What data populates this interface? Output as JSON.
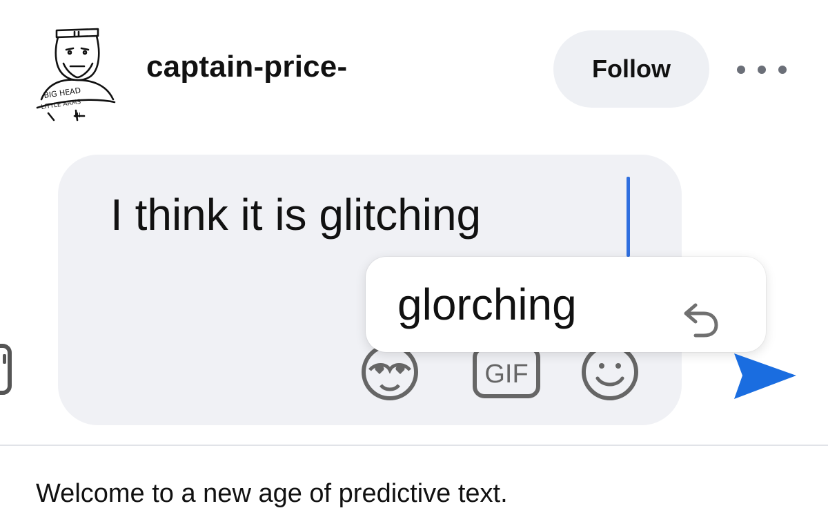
{
  "post": {
    "author": {
      "username": "captain-price-",
      "avatar_icon": "sketch-avatar-icon",
      "avatar_lettering": [
        "BIG HEAD",
        "LITTLE ARMS",
        "III"
      ]
    },
    "follow_label": "Follow",
    "more_icon": "more-options-icon"
  },
  "composer": {
    "message_text": "I think it is glitching",
    "cursor_color": "#2f6fdf",
    "suggestion": {
      "text": "glorching",
      "icon": "undo-icon"
    },
    "icons": [
      "emoji-hearts-icon",
      "gif-icon",
      "smiley-icon"
    ],
    "gif_label": "GIF",
    "send_icon": "send-icon",
    "send_color": "#1a6de0"
  },
  "caption": "Welcome to a new age of predictive text."
}
